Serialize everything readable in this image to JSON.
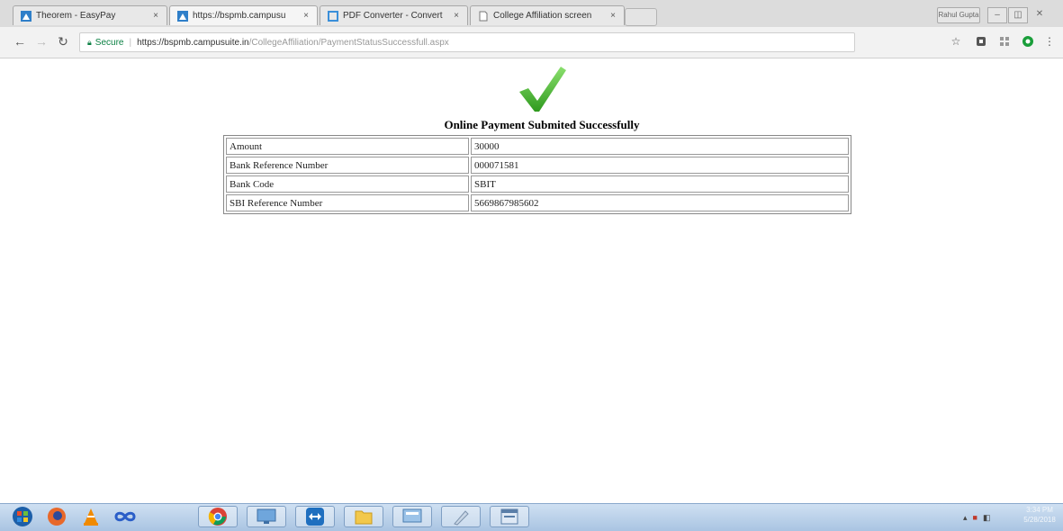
{
  "browser": {
    "tabs": [
      {
        "label": "Theorem - EasyPay",
        "icon": "campussuite-icon",
        "active": false
      },
      {
        "label": "https://bspmb.campusu",
        "icon": "campussuite-icon",
        "active": true
      },
      {
        "label": "PDF Converter - Convert",
        "icon": "pdf-converter-icon",
        "active": false
      },
      {
        "label": "College Affiliation screen",
        "icon": "document-icon",
        "active": false
      }
    ],
    "tab_close_glyph": "×",
    "profile_label": "Rahul Gupta",
    "address": {
      "security_label": "Secure",
      "url_base": "https://bspmb.campusuite.in",
      "url_path": "/CollegeAffiliation/PaymentStatusSuccessfull.aspx"
    }
  },
  "page": {
    "heading": "Online Payment Submited Successfully",
    "check_color": "#3aa524",
    "rows": [
      {
        "label": "Amount",
        "value": "30000"
      },
      {
        "label": "Bank Reference Number",
        "value": "000071581"
      },
      {
        "label": "Bank Code",
        "value": "SBIT"
      },
      {
        "label": "SBI Reference Number",
        "value": "5669867985602"
      }
    ]
  },
  "taskbar": {
    "clock_time": "3:34 PM",
    "clock_date": "5/28/2018",
    "apps": [
      "start-orb-icon",
      "firefox-icon",
      "vlc-icon",
      "infinity-icon",
      "chrome-icon",
      "remote-desktop-icon",
      "teamviewer-icon",
      "file-explorer-icon",
      "desktop-app-icon",
      "paint-icon",
      "window-app-icon"
    ]
  }
}
